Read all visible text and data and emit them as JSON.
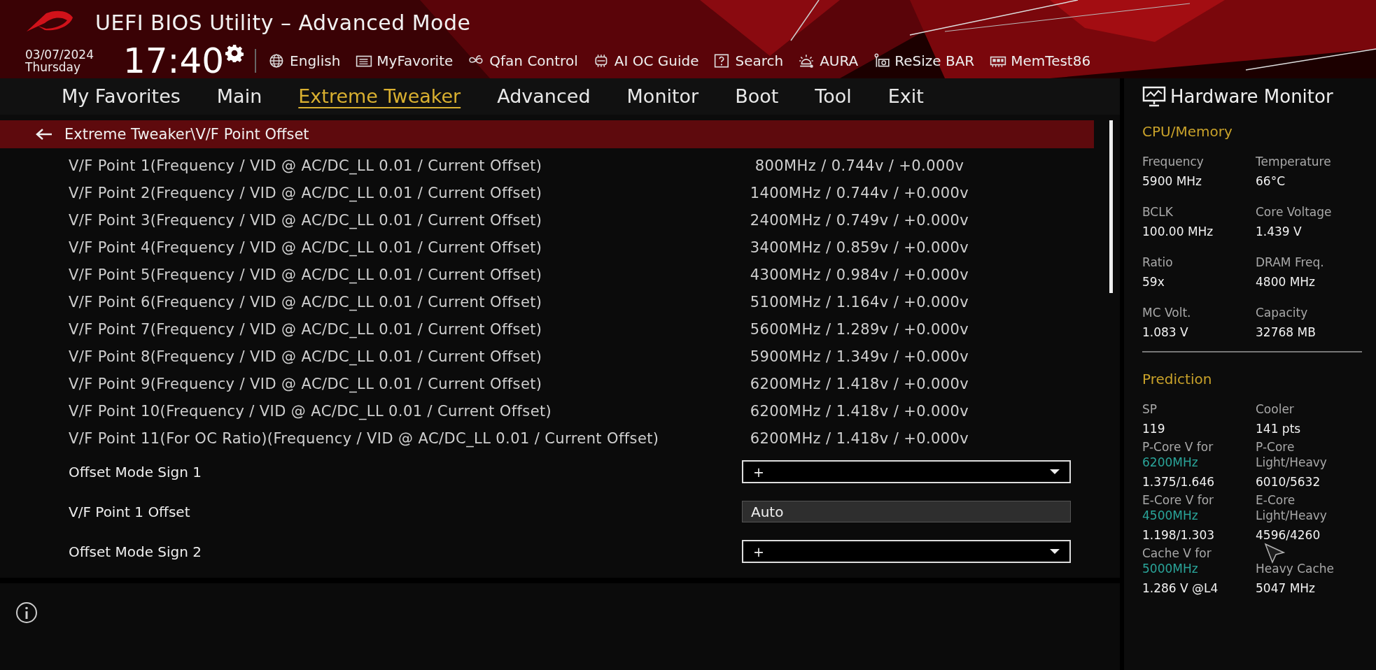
{
  "header": {
    "title": "UEFI BIOS Utility – Advanced Mode",
    "date": "03/07/2024",
    "day": "Thursday",
    "time": "17:40",
    "tools": [
      {
        "kind": "globe",
        "label": "English"
      },
      {
        "kind": "favorite",
        "label": "MyFavorite"
      },
      {
        "kind": "fan",
        "label": "Qfan Control"
      },
      {
        "kind": "chip",
        "label": "AI OC Guide"
      },
      {
        "kind": "help",
        "label": "Search"
      },
      {
        "kind": "light",
        "label": "AURA"
      },
      {
        "kind": "card",
        "label": "ReSize BAR"
      },
      {
        "kind": "memory",
        "label": "MemTest86"
      }
    ]
  },
  "tabs": [
    {
      "label": "My Favorites",
      "selected": false
    },
    {
      "label": "Main",
      "selected": false
    },
    {
      "label": "Extreme Tweaker",
      "selected": true
    },
    {
      "label": "Advanced",
      "selected": false
    },
    {
      "label": "Monitor",
      "selected": false
    },
    {
      "label": "Boot",
      "selected": false
    },
    {
      "label": "Tool",
      "selected": false
    },
    {
      "label": "Exit",
      "selected": false
    }
  ],
  "breadcrumb": "Extreme Tweaker\\V/F Point Offset",
  "info_rows": [
    {
      "label": "V/F Point 1(Frequency / VID @ AC/DC_LL 0.01 / Current Offset)",
      "value": "800MHz / 0.744v / +0.000v"
    },
    {
      "label": "V/F Point 2(Frequency / VID @ AC/DC_LL 0.01 / Current Offset)",
      "value": "1400MHz / 0.744v / +0.000v"
    },
    {
      "label": "V/F Point 3(Frequency / VID @ AC/DC_LL 0.01 / Current Offset)",
      "value": "2400MHz / 0.749v / +0.000v"
    },
    {
      "label": "V/F Point 4(Frequency / VID @ AC/DC_LL 0.01 / Current Offset)",
      "value": "3400MHz / 0.859v / +0.000v"
    },
    {
      "label": "V/F Point 5(Frequency / VID @ AC/DC_LL 0.01 / Current Offset)",
      "value": "4300MHz / 0.984v / +0.000v"
    },
    {
      "label": "V/F Point 6(Frequency / VID @ AC/DC_LL 0.01 / Current Offset)",
      "value": "5100MHz / 1.164v / +0.000v"
    },
    {
      "label": "V/F Point 7(Frequency / VID @ AC/DC_LL 0.01 / Current Offset)",
      "value": "5600MHz / 1.289v / +0.000v"
    },
    {
      "label": "V/F Point 8(Frequency / VID @ AC/DC_LL 0.01 / Current Offset)",
      "value": "5900MHz / 1.349v / +0.000v"
    },
    {
      "label": "V/F Point 9(Frequency / VID @ AC/DC_LL 0.01 / Current Offset)",
      "value": "6200MHz / 1.418v / +0.000v"
    },
    {
      "label": "V/F Point 10(Frequency / VID @ AC/DC_LL 0.01 / Current Offset)",
      "value": "6200MHz / 1.418v / +0.000v"
    },
    {
      "label": "V/F Point 11(For OC Ratio)(Frequency / VID @ AC/DC_LL 0.01 / Current Offset)",
      "value": "6200MHz / 1.418v / +0.000v"
    }
  ],
  "settings": [
    {
      "kind": "dropdown",
      "label": "Offset Mode Sign 1",
      "value": "+"
    },
    {
      "kind": "input",
      "label": "V/F Point 1 Offset",
      "value": "Auto"
    },
    {
      "kind": "dropdown",
      "label": "Offset Mode Sign 2",
      "value": "+"
    }
  ],
  "hardware_monitor": {
    "title": "Hardware Monitor",
    "sections": [
      {
        "title": "CPU/Memory",
        "items": [
          {
            "label": "Frequency",
            "value": "5900 MHz"
          },
          {
            "label": "Temperature",
            "value": "66°C"
          },
          {
            "label": "BCLK",
            "value": "100.00 MHz"
          },
          {
            "label": "Core Voltage",
            "value": "1.439 V"
          },
          {
            "label": "Ratio",
            "value": "59x"
          },
          {
            "label": "DRAM Freq.",
            "value": "4800 MHz"
          },
          {
            "label": "MC Volt.",
            "value": "1.083 V"
          },
          {
            "label": "Capacity",
            "value": "32768 MB"
          }
        ]
      },
      {
        "title": "Prediction",
        "items": [
          {
            "label": "SP",
            "value": "119"
          },
          {
            "label": "Cooler",
            "value": "141 pts"
          },
          {
            "label": "P-Core V for",
            "note": "6200MHz",
            "value": "1.375/1.646"
          },
          {
            "label": "P-Core Light/Heavy",
            "value": "6010/5632"
          },
          {
            "label": "E-Core V for",
            "note": "4500MHz",
            "value": "1.198/1.303"
          },
          {
            "label": "E-Core Light/Heavy",
            "value": "4596/4260"
          },
          {
            "label": "Cache V for",
            "note": "5000MHz",
            "value": "1.286 V @L4"
          },
          {
            "label": "Heavy Cache",
            "value": "5047 MHz"
          }
        ]
      }
    ]
  }
}
